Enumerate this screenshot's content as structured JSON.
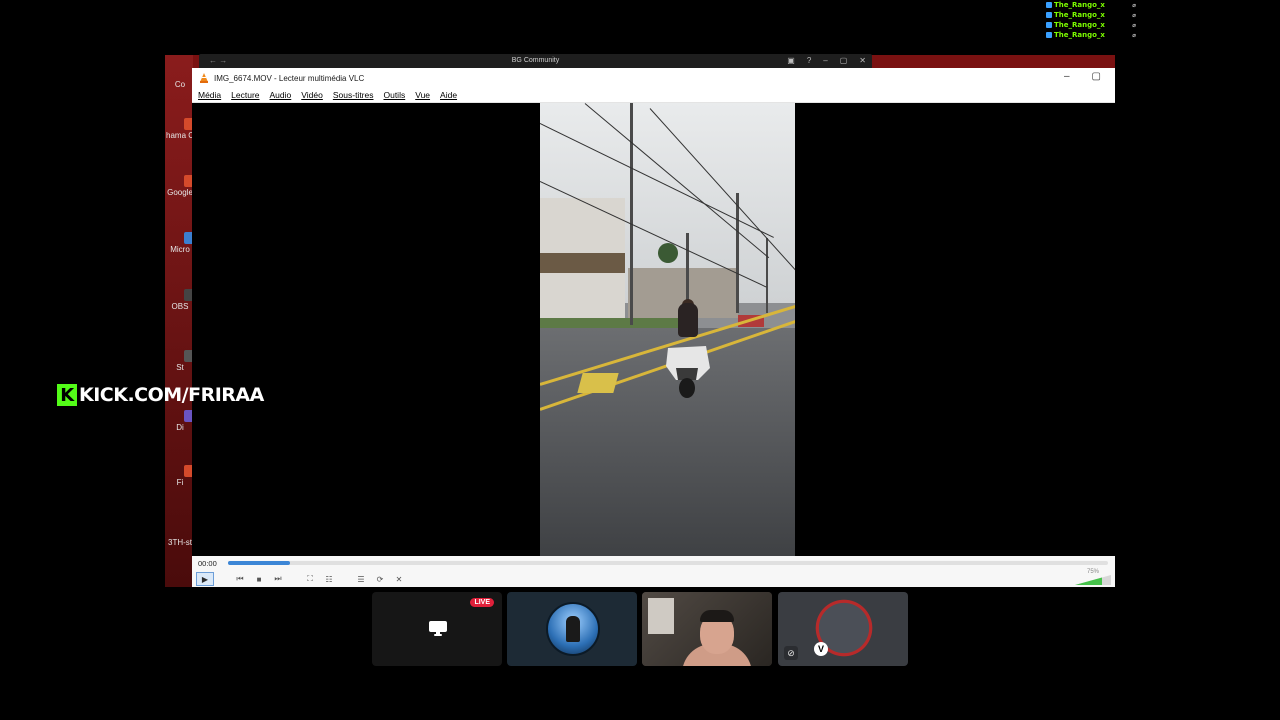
{
  "chat": {
    "lines": [
      {
        "user": "The_Rango_x",
        "tag": "⌀"
      },
      {
        "user": "The_Rango_x",
        "tag": "⌀"
      },
      {
        "user": "The_Rango_x",
        "tag": "⌀"
      },
      {
        "user": "The_Rango_x",
        "tag": "⌀"
      }
    ]
  },
  "desktop": {
    "icons": [
      "Co",
      "hama Chro",
      "Google",
      "Micro",
      "OBS",
      "St",
      "Di",
      "Fi",
      "3TH-st"
    ]
  },
  "bg_window": {
    "title": "BG Community",
    "nav": "← →"
  },
  "vlc": {
    "title": "IMG_6674.MOV - Lecteur multimédia VLC",
    "menu": [
      "Média",
      "Lecture",
      "Audio",
      "Vidéo",
      "Sous-titres",
      "Outils",
      "Vue",
      "Aide"
    ],
    "time": "00:00",
    "progress": 0.07,
    "volume_label": "75%",
    "accent_color": "#3c86d6"
  },
  "kick": {
    "logo": "K",
    "text": "KICK.COM/FRIRAA",
    "brand_color": "#53fc18"
  },
  "call": {
    "live_badge": "LIVE",
    "pin_badge": "V"
  }
}
